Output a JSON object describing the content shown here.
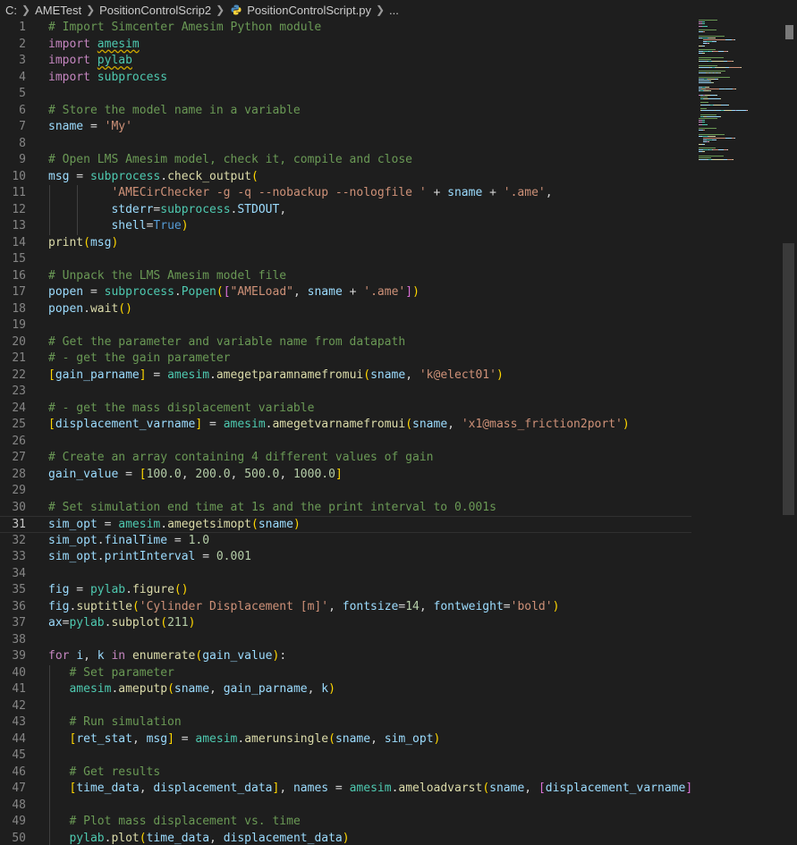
{
  "breadcrumb": {
    "items": [
      "C:",
      "AMETest",
      "PositionControlScrip2",
      "PositionControlScript.py",
      "..."
    ]
  },
  "colors": {
    "comment": "#6a9955",
    "keyword": "#c586c0",
    "module": "#4ec9b0",
    "variable": "#9cdcfe",
    "function": "#dcdcaa",
    "string": "#ce9178",
    "number": "#b5cea8",
    "constant": "#569cd6"
  },
  "editor": {
    "current_line": 31,
    "lines": [
      {
        "n": "1",
        "t": [
          [
            "cm",
            "# Import Simcenter Amesim Python module"
          ]
        ]
      },
      {
        "n": "2",
        "t": [
          [
            "kw",
            "import "
          ],
          [
            "mod warn",
            "amesim"
          ]
        ]
      },
      {
        "n": "3",
        "t": [
          [
            "kw",
            "import "
          ],
          [
            "mod warn",
            "pylab"
          ]
        ]
      },
      {
        "n": "4",
        "t": [
          [
            "kw",
            "import "
          ],
          [
            "mod",
            "subprocess"
          ]
        ]
      },
      {
        "n": "5",
        "t": []
      },
      {
        "n": "6",
        "t": [
          [
            "cm",
            "# Store the model name in a variable"
          ]
        ]
      },
      {
        "n": "7",
        "t": [
          [
            "var",
            "sname"
          ],
          [
            "op",
            " = "
          ],
          [
            "str",
            "'My'"
          ]
        ]
      },
      {
        "n": "8",
        "t": []
      },
      {
        "n": "9",
        "t": [
          [
            "cm",
            "# Open LMS Amesim model, check it, compile and close"
          ]
        ]
      },
      {
        "n": "10",
        "t": [
          [
            "var",
            "msg"
          ],
          [
            "op",
            " = "
          ],
          [
            "mod",
            "subprocess"
          ],
          [
            "op",
            "."
          ],
          [
            "fn",
            "check_output"
          ],
          [
            "br1",
            "("
          ]
        ]
      },
      {
        "n": "11",
        "t": [
          [
            "op",
            "         "
          ],
          [
            "str",
            "'AMECirChecker -g -q --nobackup --nologfile '"
          ],
          [
            "op",
            " + "
          ],
          [
            "var",
            "sname"
          ],
          [
            "op",
            " + "
          ],
          [
            "str",
            "'.ame'"
          ],
          [
            "op",
            ","
          ]
        ]
      },
      {
        "n": "12",
        "t": [
          [
            "op",
            "         "
          ],
          [
            "var",
            "stderr"
          ],
          [
            "op",
            "="
          ],
          [
            "mod",
            "subprocess"
          ],
          [
            "op",
            "."
          ],
          [
            "var",
            "STDOUT"
          ],
          [
            "op",
            ","
          ]
        ]
      },
      {
        "n": "13",
        "t": [
          [
            "op",
            "         "
          ],
          [
            "var",
            "shell"
          ],
          [
            "op",
            "="
          ],
          [
            "const",
            "True"
          ],
          [
            "br1",
            ")"
          ]
        ]
      },
      {
        "n": "14",
        "t": [
          [
            "fn",
            "print"
          ],
          [
            "br1",
            "("
          ],
          [
            "var",
            "msg"
          ],
          [
            "br1",
            ")"
          ]
        ]
      },
      {
        "n": "15",
        "t": []
      },
      {
        "n": "16",
        "t": [
          [
            "cm",
            "# Unpack the LMS Amesim model file"
          ]
        ]
      },
      {
        "n": "17",
        "t": [
          [
            "var",
            "popen"
          ],
          [
            "op",
            " = "
          ],
          [
            "mod",
            "subprocess"
          ],
          [
            "op",
            "."
          ],
          [
            "mod",
            "Popen"
          ],
          [
            "br1",
            "("
          ],
          [
            "br2",
            "["
          ],
          [
            "str",
            "\"AMELoad\""
          ],
          [
            "op",
            ", "
          ],
          [
            "var",
            "sname"
          ],
          [
            "op",
            " + "
          ],
          [
            "str",
            "'.ame'"
          ],
          [
            "br2",
            "]"
          ],
          [
            "br1",
            ")"
          ]
        ]
      },
      {
        "n": "18",
        "t": [
          [
            "var",
            "popen"
          ],
          [
            "op",
            "."
          ],
          [
            "fn",
            "wait"
          ],
          [
            "br1",
            "()"
          ]
        ]
      },
      {
        "n": "19",
        "t": []
      },
      {
        "n": "20",
        "t": [
          [
            "cm",
            "# Get the parameter and variable name from datapath"
          ]
        ]
      },
      {
        "n": "21",
        "t": [
          [
            "cm",
            "# - get the gain parameter"
          ]
        ]
      },
      {
        "n": "22",
        "t": [
          [
            "br1",
            "["
          ],
          [
            "var",
            "gain_parname"
          ],
          [
            "br1",
            "]"
          ],
          [
            "op",
            " = "
          ],
          [
            "mod",
            "amesim"
          ],
          [
            "op",
            "."
          ],
          [
            "fn",
            "amegetparamnamefromui"
          ],
          [
            "br1",
            "("
          ],
          [
            "var",
            "sname"
          ],
          [
            "op",
            ", "
          ],
          [
            "str",
            "'k@elect01'"
          ],
          [
            "br1",
            ")"
          ]
        ]
      },
      {
        "n": "23",
        "t": []
      },
      {
        "n": "24",
        "t": [
          [
            "cm",
            "# - get the mass displacement variable"
          ]
        ]
      },
      {
        "n": "25",
        "t": [
          [
            "br1",
            "["
          ],
          [
            "var",
            "displacement_varname"
          ],
          [
            "br1",
            "]"
          ],
          [
            "op",
            " = "
          ],
          [
            "mod",
            "amesim"
          ],
          [
            "op",
            "."
          ],
          [
            "fn",
            "amegetvarnamefromui"
          ],
          [
            "br1",
            "("
          ],
          [
            "var",
            "sname"
          ],
          [
            "op",
            ", "
          ],
          [
            "str",
            "'x1@mass_friction2port'"
          ],
          [
            "br1",
            ")"
          ]
        ]
      },
      {
        "n": "26",
        "t": []
      },
      {
        "n": "27",
        "t": [
          [
            "cm",
            "# Create an array containing 4 different values of gain"
          ]
        ]
      },
      {
        "n": "28",
        "t": [
          [
            "var",
            "gain_value"
          ],
          [
            "op",
            " = "
          ],
          [
            "br1",
            "["
          ],
          [
            "num",
            "100.0"
          ],
          [
            "op",
            ", "
          ],
          [
            "num",
            "200.0"
          ],
          [
            "op",
            ", "
          ],
          [
            "num",
            "500.0"
          ],
          [
            "op",
            ", "
          ],
          [
            "num",
            "1000.0"
          ],
          [
            "br1",
            "]"
          ]
        ]
      },
      {
        "n": "29",
        "t": []
      },
      {
        "n": "30",
        "t": [
          [
            "cm",
            "# Set simulation end time at 1s and the print interval to 0.001s"
          ]
        ]
      },
      {
        "n": "31",
        "t": [
          [
            "var",
            "sim_opt"
          ],
          [
            "op",
            " = "
          ],
          [
            "mod",
            "amesim"
          ],
          [
            "op",
            "."
          ],
          [
            "fn",
            "amegetsimopt"
          ],
          [
            "br1",
            "("
          ],
          [
            "var",
            "sname"
          ],
          [
            "br1",
            ")"
          ]
        ]
      },
      {
        "n": "32",
        "t": [
          [
            "var",
            "sim_opt"
          ],
          [
            "op",
            "."
          ],
          [
            "var",
            "finalTime"
          ],
          [
            "op",
            " = "
          ],
          [
            "num",
            "1.0"
          ]
        ]
      },
      {
        "n": "33",
        "t": [
          [
            "var",
            "sim_opt"
          ],
          [
            "op",
            "."
          ],
          [
            "var",
            "printInterval"
          ],
          [
            "op",
            " = "
          ],
          [
            "num",
            "0.001"
          ]
        ]
      },
      {
        "n": "34",
        "t": []
      },
      {
        "n": "35",
        "t": [
          [
            "var",
            "fig"
          ],
          [
            "op",
            " = "
          ],
          [
            "mod",
            "pylab"
          ],
          [
            "op",
            "."
          ],
          [
            "fn",
            "figure"
          ],
          [
            "br1",
            "()"
          ]
        ]
      },
      {
        "n": "36",
        "t": [
          [
            "var",
            "fig"
          ],
          [
            "op",
            "."
          ],
          [
            "fn",
            "suptitle"
          ],
          [
            "br1",
            "("
          ],
          [
            "str",
            "'Cylinder Displacement [m]'"
          ],
          [
            "op",
            ", "
          ],
          [
            "var",
            "fontsize"
          ],
          [
            "op",
            "="
          ],
          [
            "num",
            "14"
          ],
          [
            "op",
            ", "
          ],
          [
            "var",
            "fontweight"
          ],
          [
            "op",
            "="
          ],
          [
            "str",
            "'bold'"
          ],
          [
            "br1",
            ")"
          ]
        ]
      },
      {
        "n": "37",
        "t": [
          [
            "var",
            "ax"
          ],
          [
            "op",
            "="
          ],
          [
            "mod",
            "pylab"
          ],
          [
            "op",
            "."
          ],
          [
            "fn",
            "subplot"
          ],
          [
            "br1",
            "("
          ],
          [
            "num",
            "211"
          ],
          [
            "br1",
            ")"
          ]
        ]
      },
      {
        "n": "38",
        "t": []
      },
      {
        "n": "39",
        "t": [
          [
            "kw",
            "for "
          ],
          [
            "var",
            "i"
          ],
          [
            "op",
            ", "
          ],
          [
            "var",
            "k"
          ],
          [
            "kw",
            " in "
          ],
          [
            "fn",
            "enumerate"
          ],
          [
            "br1",
            "("
          ],
          [
            "var",
            "gain_value"
          ],
          [
            "br1",
            ")"
          ],
          [
            "op",
            ":"
          ]
        ]
      },
      {
        "n": "40",
        "t": [
          [
            "op",
            "   "
          ],
          [
            "cm",
            "# Set parameter"
          ]
        ]
      },
      {
        "n": "41",
        "t": [
          [
            "op",
            "   "
          ],
          [
            "mod",
            "amesim"
          ],
          [
            "op",
            "."
          ],
          [
            "fn",
            "ameputp"
          ],
          [
            "br1",
            "("
          ],
          [
            "var",
            "sname"
          ],
          [
            "op",
            ", "
          ],
          [
            "var",
            "gain_parname"
          ],
          [
            "op",
            ", "
          ],
          [
            "var",
            "k"
          ],
          [
            "br1",
            ")"
          ]
        ]
      },
      {
        "n": "42",
        "t": []
      },
      {
        "n": "43",
        "t": [
          [
            "op",
            "   "
          ],
          [
            "cm",
            "# Run simulation"
          ]
        ]
      },
      {
        "n": "44",
        "t": [
          [
            "op",
            "   "
          ],
          [
            "br1",
            "["
          ],
          [
            "var",
            "ret_stat"
          ],
          [
            "op",
            ", "
          ],
          [
            "var",
            "msg"
          ],
          [
            "br1",
            "]"
          ],
          [
            "op",
            " = "
          ],
          [
            "mod",
            "amesim"
          ],
          [
            "op",
            "."
          ],
          [
            "fn",
            "amerunsingle"
          ],
          [
            "br1",
            "("
          ],
          [
            "var",
            "sname"
          ],
          [
            "op",
            ", "
          ],
          [
            "var",
            "sim_opt"
          ],
          [
            "br1",
            ")"
          ]
        ]
      },
      {
        "n": "45",
        "t": []
      },
      {
        "n": "46",
        "t": [
          [
            "op",
            "   "
          ],
          [
            "cm",
            "# Get results"
          ]
        ]
      },
      {
        "n": "47",
        "t": [
          [
            "op",
            "   "
          ],
          [
            "br1",
            "["
          ],
          [
            "var",
            "time_data"
          ],
          [
            "op",
            ", "
          ],
          [
            "var",
            "displacement_data"
          ],
          [
            "br1",
            "]"
          ],
          [
            "op",
            ", "
          ],
          [
            "var",
            "names"
          ],
          [
            "op",
            " = "
          ],
          [
            "mod",
            "amesim"
          ],
          [
            "op",
            "."
          ],
          [
            "fn",
            "ameloadvarst"
          ],
          [
            "br1",
            "("
          ],
          [
            "var",
            "sname"
          ],
          [
            "op",
            ", "
          ],
          [
            "br2",
            "["
          ],
          [
            "var",
            "displacement_varname"
          ],
          [
            "br2",
            "]"
          ],
          [
            "br1",
            ")"
          ]
        ]
      },
      {
        "n": "48",
        "t": []
      },
      {
        "n": "49",
        "t": [
          [
            "op",
            "   "
          ],
          [
            "cm",
            "# Plot mass displacement vs. time"
          ]
        ]
      },
      {
        "n": "50",
        "t": [
          [
            "op",
            "   "
          ],
          [
            "mod",
            "pylab"
          ],
          [
            "op",
            "."
          ],
          [
            "fn",
            "plot"
          ],
          [
            "br1",
            "("
          ],
          [
            "var",
            "time_data"
          ],
          [
            "op",
            ", "
          ],
          [
            "var",
            "displacement_data"
          ],
          [
            "br1",
            ")"
          ]
        ]
      }
    ]
  }
}
